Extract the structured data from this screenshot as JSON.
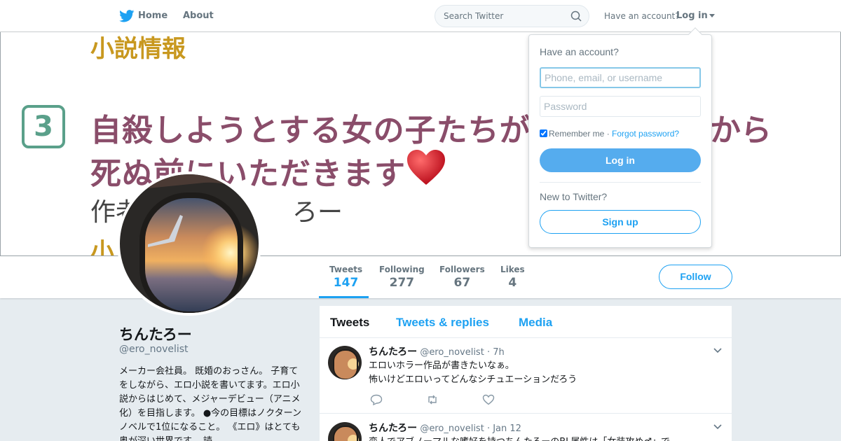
{
  "nav": {
    "home_label": "Home",
    "about_label": "About",
    "search_placeholder": "Search Twitter",
    "have_account": "Have an account?",
    "login_label": "Log in"
  },
  "banner": {
    "top_text": "小説情報",
    "number_badge": "3",
    "title_line1": "自殺しようとする女の子たちが",
    "title_line1_end": "から",
    "title_line2": "死ぬ前にいただきます",
    "author_line": "作者　　　　　　ろー",
    "bottom_text": "小"
  },
  "profile": {
    "name": "ちんたろー",
    "handle": "@ero_novelist",
    "bio": "メーカー会社員。 既婚のおっさん。 子育てをしながら、エロ小説を書いてます。エロ小説からはじめて、メジャーデビュー（アニメ化）を目指します。 ●今の目標はノクターンノベルで1位になること。 《エロ》はとても奥が深い世界です。 読"
  },
  "stats": [
    {
      "label": "Tweets",
      "value": "147"
    },
    {
      "label": "Following",
      "value": "277"
    },
    {
      "label": "Followers",
      "value": "67"
    },
    {
      "label": "Likes",
      "value": "4"
    }
  ],
  "follow_label": "Follow",
  "timeline": {
    "tabs": [
      "Tweets",
      "Tweets & replies",
      "Media"
    ],
    "tweets": [
      {
        "name": "ちんたろー",
        "handle": "@ero_novelist",
        "time": "· 7h",
        "text": "エロいホラー作品が書きたいなぁ。\n怖いけどエロいってどんなシチュエーションだろう"
      },
      {
        "name": "ちんたろー",
        "handle": "@ero_novelist",
        "time": "· Jan 12",
        "text": "変人でアブノーマルな嗜好を持つちんたろーのBL属性は「女装攻め♂」で"
      }
    ]
  },
  "login_card": {
    "title": "Have an account?",
    "username_placeholder": "Phone, email, or username",
    "password_placeholder": "Password",
    "remember_label": "Remember me",
    "separator": " · ",
    "forgot_label": "Forgot password?",
    "login_button": "Log in",
    "new_label": "New to Twitter?",
    "signup_button": "Sign up"
  },
  "colors": {
    "accent": "#1da1f2",
    "login_button_bg": "#55acee",
    "banner_purple": "#8a4d6a",
    "banner_gold": "#c8981f"
  }
}
